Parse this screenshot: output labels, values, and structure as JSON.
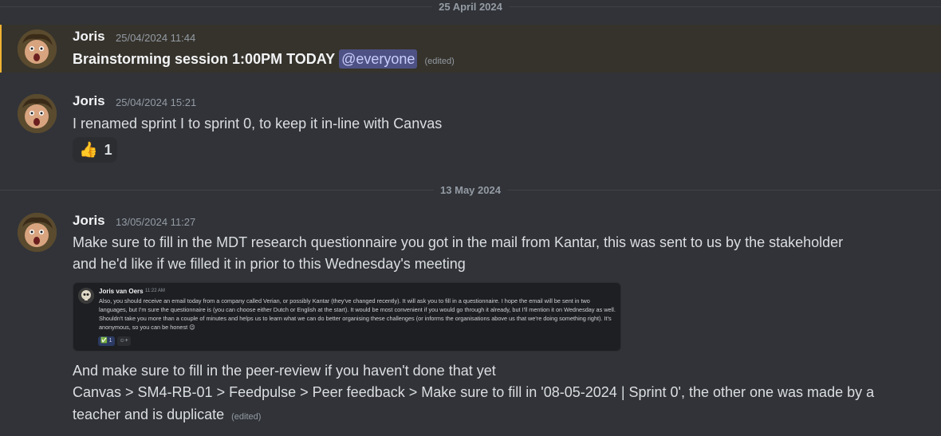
{
  "dividers": [
    "25 April 2024",
    "13 May 2024"
  ],
  "messages": [
    {
      "author": "Joris",
      "timestamp": "25/04/2024 11:44",
      "text": "Brainstorming session 1:00PM TODAY",
      "mention": "@everyone",
      "edited": "(edited)"
    },
    {
      "author": "Joris",
      "timestamp": "25/04/2024 15:21",
      "text": "I renamed sprint I to sprint 0, to keep it in-line with Canvas",
      "reaction": {
        "emoji": "👍",
        "count": "1"
      }
    },
    {
      "author": "Joris",
      "timestamp": "13/05/2024 11:27",
      "lines": [
        "Make sure to fill in the MDT research questionnaire you got in the mail from Kantar, this was sent to us by the stakeholder",
        "and he'd like if we filled it in prior to this Wednesday's meeting"
      ],
      "after_lines": [
        "And make sure to fill in the peer-review if you haven't done that yet",
        "Canvas > SM4-RB-01 > Feedpulse > Peer feedback > Make sure to fill in '08-05-2024 | Sprint 0', the other one was made by a",
        "teacher and is duplicate"
      ],
      "edited": "(edited)"
    }
  ],
  "embed": {
    "author": "Joris van Oers",
    "time": "11:22 AM",
    "body": "Also, you should receive an email today from a company called Verian, or possibly Kantar (they've changed recently). It will ask you to fill in a questionnaire. I hope the email will be sent in two languages, but I'm sure the questionnaire is (you can choose either Dutch or English at the start). It would be most convenient if you would go through it already, but I'll mention it on Wednesday as well. Shouldn't take you more than a couple of minutes and helps us to learn what we can do better organising these challenges (or informs the organisations above us that we're doing something right). It's anonymous, so you can be honest 😉",
    "reaction": "✅ 1",
    "add_reaction": "☺+"
  },
  "colors": {
    "background": "#313338",
    "mention_bg": "#36332c",
    "mention_bar": "#f0b232",
    "ping_bg": "#4e5184"
  }
}
